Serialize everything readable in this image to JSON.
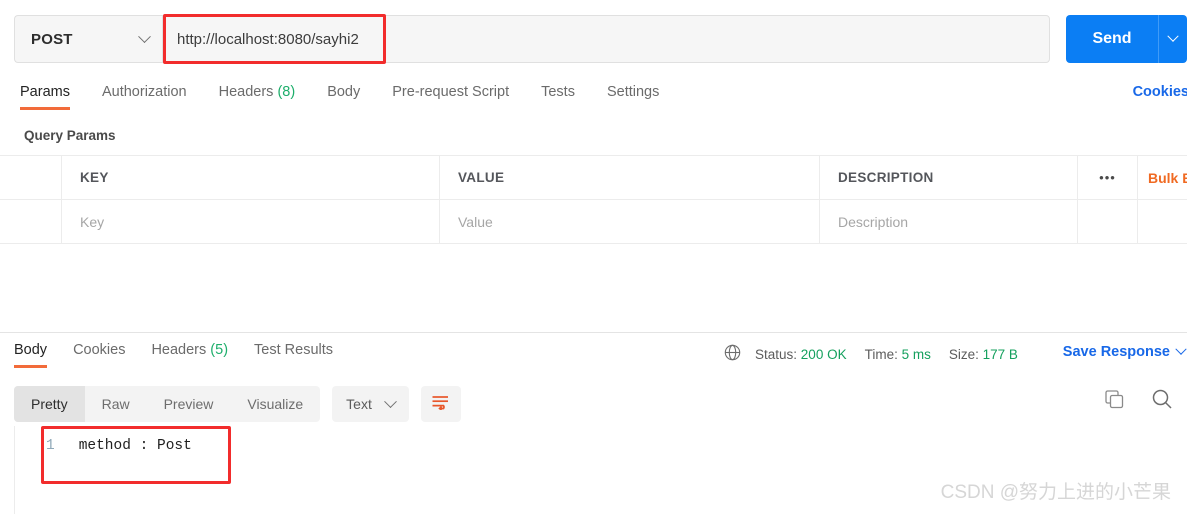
{
  "request": {
    "method": "POST",
    "url": "http://localhost:8080/sayhi2",
    "send_label": "Send",
    "tabs": [
      {
        "label": "Params",
        "count": ""
      },
      {
        "label": "Authorization",
        "count": ""
      },
      {
        "label": "Headers",
        "count": "(8)"
      },
      {
        "label": "Body",
        "count": ""
      },
      {
        "label": "Pre-request Script",
        "count": ""
      },
      {
        "label": "Tests",
        "count": ""
      },
      {
        "label": "Settings",
        "count": ""
      }
    ],
    "cookies_link": "Cookies",
    "query_params_title": "Query Params",
    "table": {
      "headers": {
        "key": "KEY",
        "value": "VALUE",
        "description": "DESCRIPTION"
      },
      "placeholders": {
        "key": "Key",
        "value": "Value",
        "description": "Description"
      },
      "options_icon": "•••",
      "bulk_edit": "Bulk Edit"
    }
  },
  "response": {
    "tabs": [
      {
        "label": "Body",
        "count": ""
      },
      {
        "label": "Cookies",
        "count": ""
      },
      {
        "label": "Headers",
        "count": "(5)"
      },
      {
        "label": "Test Results",
        "count": ""
      }
    ],
    "meta": {
      "status_label": "Status:",
      "status_value": "200 OK",
      "time_label": "Time:",
      "time_value": "5 ms",
      "size_label": "Size:",
      "size_value": "177 B"
    },
    "save_response": "Save Response",
    "view_modes": [
      "Pretty",
      "Raw",
      "Preview",
      "Visualize"
    ],
    "active_view_mode": "Pretty",
    "format": "Text",
    "body": {
      "line_number": "1",
      "text": "method : Post"
    }
  },
  "watermark": "CSDN @努力上进的小芒果",
  "colors": {
    "accent_orange": "#f26b3a",
    "link_blue": "#1868e8",
    "send_blue": "#0b7ef4",
    "success_green": "#15a05e",
    "annotation_red": "#f22c2c"
  }
}
